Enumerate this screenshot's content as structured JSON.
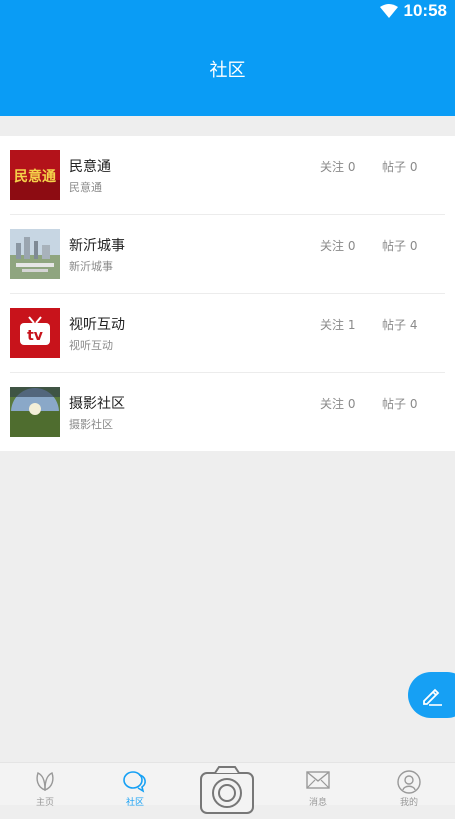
{
  "status": {
    "time": "10:58"
  },
  "header": {
    "title": "社区"
  },
  "communities": [
    {
      "title": "民意通",
      "subtitle": "民意通",
      "follow": "关注 0",
      "posts": "帖子 0",
      "thumb_text": "民意通"
    },
    {
      "title": "新沂城事",
      "subtitle": "新沂城事",
      "follow": "关注 0",
      "posts": "帖子 0"
    },
    {
      "title": "视听互动",
      "subtitle": "视听互动",
      "follow": "关注 1",
      "posts": "帖子 4",
      "thumb_text": "tv"
    },
    {
      "title": "摄影社区",
      "subtitle": "摄影社区",
      "follow": "关注 0",
      "posts": "帖子 0"
    }
  ],
  "tabs": [
    {
      "label": "主页",
      "icon": "leaf-icon"
    },
    {
      "label": "社区",
      "icon": "chat-bubbles-icon"
    },
    {
      "label": "消息",
      "icon": "envelope-icon"
    },
    {
      "label": "我的",
      "icon": "user-icon"
    }
  ],
  "colors": {
    "primary": "#0a9cf5",
    "fab": "#16a0f4"
  }
}
